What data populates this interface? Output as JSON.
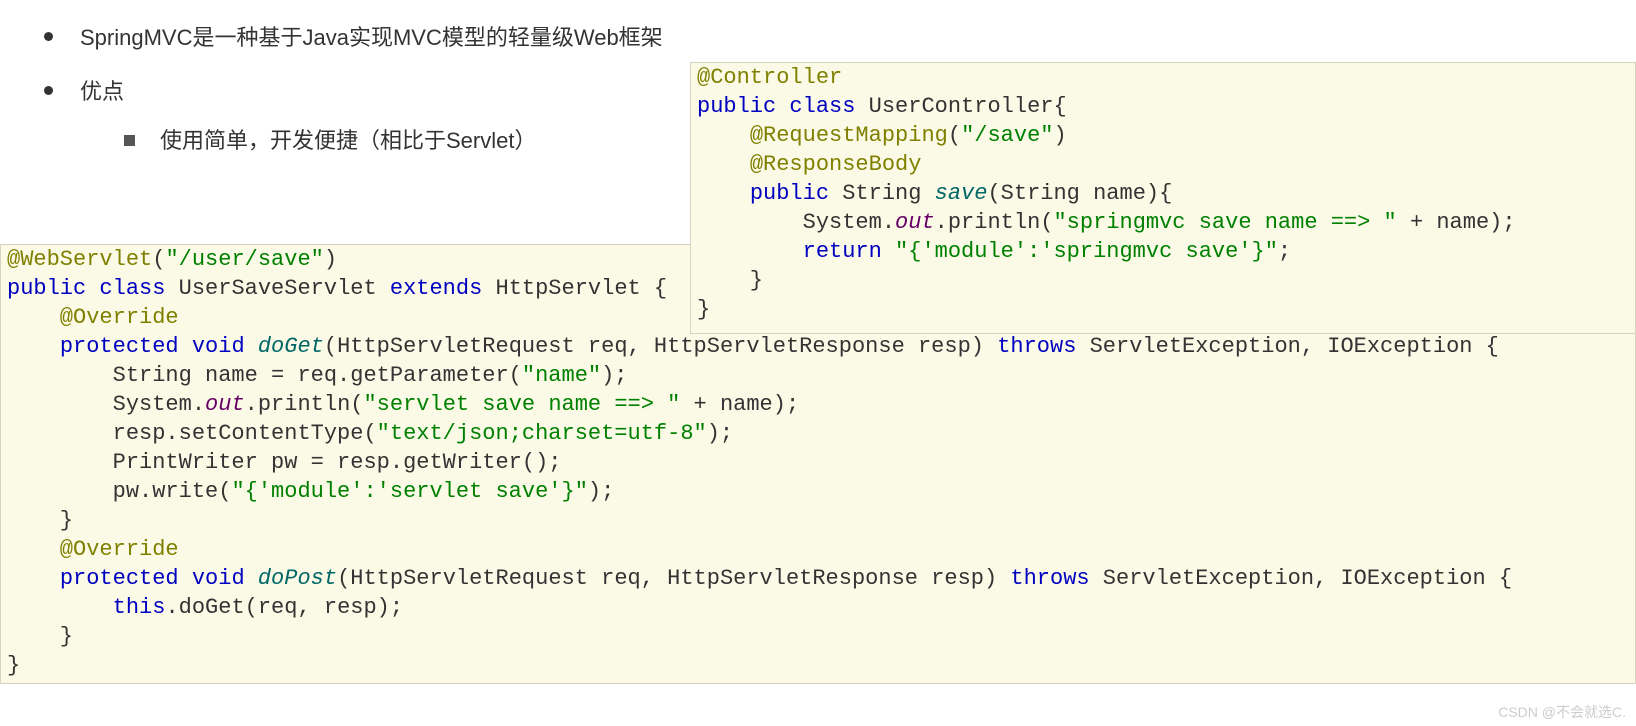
{
  "bullets": {
    "item1": "SpringMVC是一种基于Java实现MVC模型的轻量级Web框架",
    "item2": "优点",
    "sub1": "使用简单，开发便捷（相比于Servlet）"
  },
  "code1": {
    "l1_ann": "@WebServlet",
    "l1_p": "(",
    "l1_s": "\"/user/save\"",
    "l1_p2": ")",
    "l2_a": "public",
    "l2_b": " ",
    "l2_c": "class",
    "l2_d": " UserSaveServlet ",
    "l2_e": "extends",
    "l2_f": " HttpServlet {",
    "l3_ann": "    @Override",
    "l4_a": "    ",
    "l4_b": "protected",
    "l4_c": " ",
    "l4_d": "void",
    "l4_e": " ",
    "l4_m": "doGet",
    "l4_f": "(HttpServletRequest req, HttpServletResponse resp) ",
    "l4_g": "throws",
    "l4_h": " ServletException, IOException {",
    "l5_a": "        String name = req.getParameter(",
    "l5_s": "\"name\"",
    "l5_b": ");",
    "l6_a": "        System.",
    "l6_f": "out",
    "l6_b": ".println(",
    "l6_s": "\"servlet save name ==> \"",
    "l6_c": " + name);",
    "l7_a": "        resp.setContentType(",
    "l7_s": "\"text/json;charset=utf-8\"",
    "l7_b": ");",
    "l8": "        PrintWriter pw = resp.getWriter();",
    "l9_a": "        pw.write(",
    "l9_s": "\"{'module':'servlet save'}\"",
    "l9_b": ");",
    "l10": "    }",
    "l11_ann": "    @Override",
    "l12_a": "    ",
    "l12_b": "protected",
    "l12_c": " ",
    "l12_d": "void",
    "l12_e": " ",
    "l12_m": "doPost",
    "l12_f": "(HttpServletRequest req, HttpServletResponse resp) ",
    "l12_g": "throws",
    "l12_h": " ServletException, IOException {",
    "l13_a": "        ",
    "l13_b": "this",
    "l13_c": ".doGet(req, resp);",
    "l14": "    }",
    "l15": "}"
  },
  "code2": {
    "l1_ann": "@Controller",
    "l2_a": "public",
    "l2_b": " ",
    "l2_c": "class",
    "l2_d": " UserController{",
    "l3_a": "    ",
    "l3_ann": "@RequestMapping",
    "l3_p": "(",
    "l3_s": "\"/save\"",
    "l3_p2": ")",
    "l4_a": "    ",
    "l4_ann": "@ResponseBody",
    "l5_a": "    ",
    "l5_b": "public",
    "l5_c": " String ",
    "l5_m": "save",
    "l5_d": "(String name){",
    "l6_a": "        System.",
    "l6_f": "out",
    "l6_b": ".println(",
    "l6_s": "\"springmvc save name ==> \"",
    "l6_c": " + name);",
    "l7_a": "        ",
    "l7_b": "return",
    "l7_c": " ",
    "l7_s": "\"{'module':'springmvc save'}\"",
    "l7_d": ";",
    "l8": "    }",
    "l9": "}"
  },
  "watermark": "CSDN @不会就选C."
}
